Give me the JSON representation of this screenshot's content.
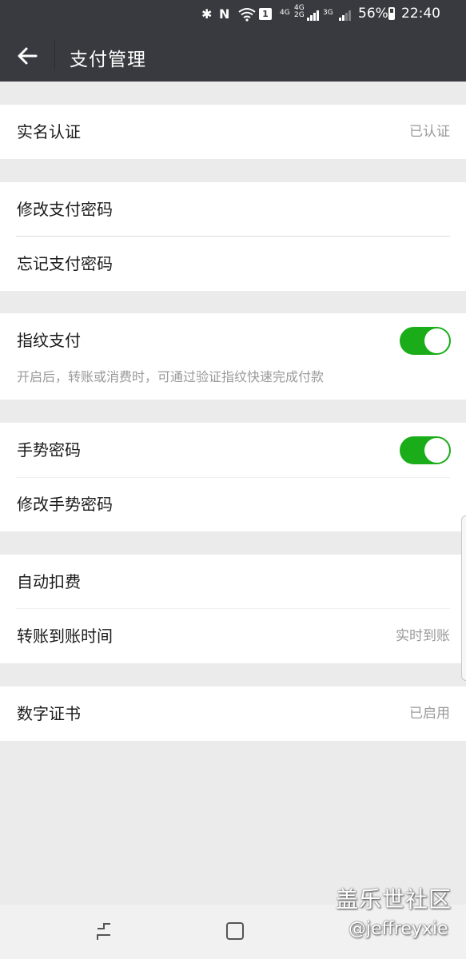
{
  "status_bar": {
    "network_4g": "4G",
    "network_4g_2g": "4G 2G",
    "network_3g": "3G",
    "sim_label": "1",
    "battery": "56%",
    "time": "22:40"
  },
  "header": {
    "title": "支付管理"
  },
  "groups": {
    "identity": {
      "label": "实名认证",
      "value": "已认证"
    },
    "password": {
      "change_label": "修改支付密码",
      "forgot_label": "忘记支付密码"
    },
    "fingerprint": {
      "label": "指纹支付",
      "enabled": true,
      "description": "开启后，转账或消费时，可通过验证指纹快速完成付款"
    },
    "gesture": {
      "label": "手势密码",
      "enabled": true,
      "change_label": "修改手势密码"
    },
    "auto": {
      "label": "自动扣费",
      "transfer_label": "转账到账时间",
      "transfer_value": "实时到账"
    },
    "certificate": {
      "label": "数字证书",
      "value": "已启用"
    }
  },
  "watermark": {
    "line1": "盖乐世社区",
    "line2": "@jeffreyxie"
  },
  "colors": {
    "accent_green": "#1aad19",
    "header_bg": "#393a3f",
    "page_bg": "#ebebeb"
  }
}
